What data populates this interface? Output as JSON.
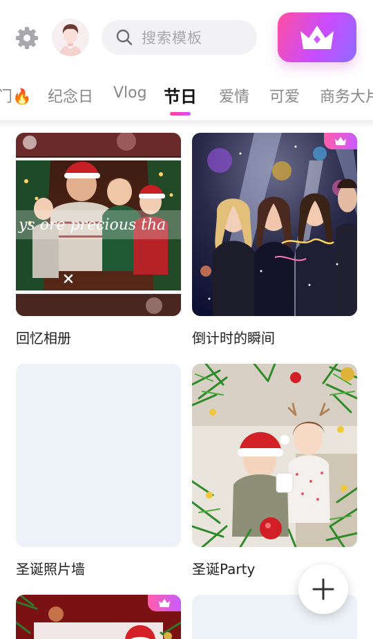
{
  "header": {
    "settings_icon": "gear-icon",
    "avatar_icon": "user-avatar",
    "search": {
      "placeholder": "搜索模板",
      "icon": "search-icon"
    },
    "vip_icon": "crown-icon"
  },
  "tabs": [
    {
      "label": "门🔥",
      "active": false
    },
    {
      "label": "纪念日",
      "active": false
    },
    {
      "label": "Vlog",
      "active": false
    },
    {
      "label": "节日",
      "active": true
    },
    {
      "label": "爱情",
      "active": false
    },
    {
      "label": "可爱",
      "active": false
    },
    {
      "label": "商务大片",
      "active": false
    }
  ],
  "colors": {
    "accent_start": "#ff3f9a",
    "accent_end": "#d452ff",
    "placeholder_bg": "#edf2f9"
  },
  "templates": [
    {
      "title": "回忆相册",
      "premium": false,
      "overlay_text": "ys ore precious tha"
    },
    {
      "title": "倒计时的瞬间",
      "premium": true
    },
    {
      "title": "圣诞照片墙",
      "premium": false
    },
    {
      "title": "圣诞Party",
      "premium": false
    },
    {
      "title": "",
      "premium": true
    },
    {
      "title": "",
      "premium": false
    }
  ],
  "fab": {
    "icon": "plus-icon"
  }
}
